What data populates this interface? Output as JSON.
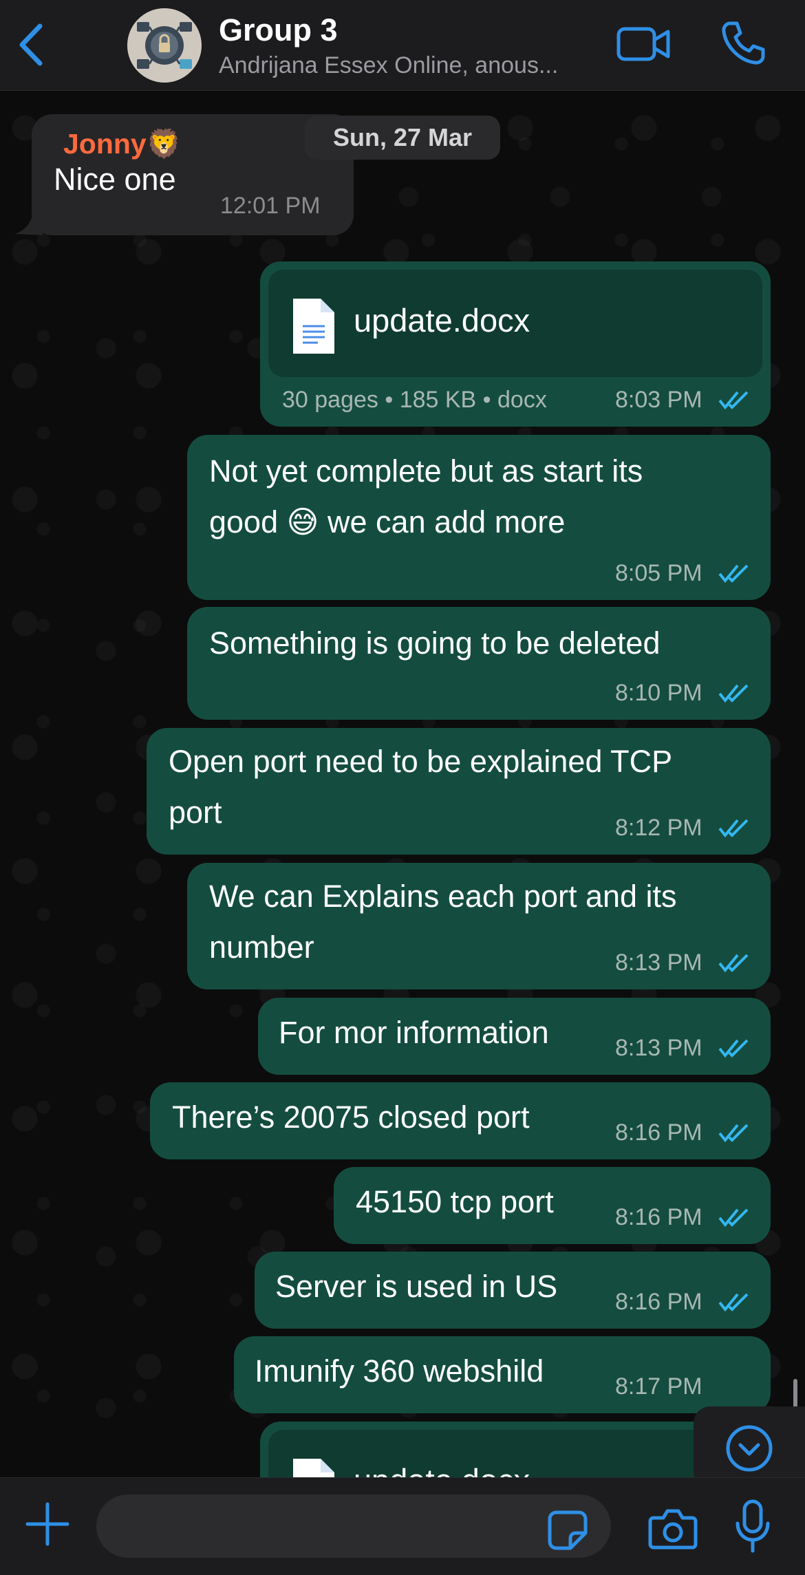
{
  "header": {
    "title": "Group 3",
    "subtitle": "Andrijana Essex Online, anous..."
  },
  "date_separator": "Sun, 27 Mar",
  "messages": [
    {
      "direction": "in",
      "sender": "Jonny",
      "sender_emoji": "🦁",
      "lines": [
        "Nice one"
      ],
      "time": "12:01 PM"
    },
    {
      "direction": "out",
      "type": "document",
      "file_name": "update.docx",
      "meta": "30 pages • 185 KB • docx",
      "time": "8:03 PM",
      "status": "read"
    },
    {
      "direction": "out",
      "lines": [
        "Not yet complete but as start its",
        "good 😅 we can add more"
      ],
      "time": "8:05 PM",
      "status": "read"
    },
    {
      "direction": "out",
      "lines": [
        "Something is going to be deleted"
      ],
      "time": "8:10 PM",
      "status": "read"
    },
    {
      "direction": "out",
      "lines": [
        "Open port need to be explained  TCP",
        "port"
      ],
      "time": "8:12 PM",
      "status": "read"
    },
    {
      "direction": "out",
      "lines": [
        "We can Explains each port and its",
        "number"
      ],
      "time": "8:13 PM",
      "status": "read"
    },
    {
      "direction": "out",
      "lines": [
        "For mor information"
      ],
      "time": "8:13 PM",
      "status": "read"
    },
    {
      "direction": "out",
      "lines": [
        "There’s 20075 closed port"
      ],
      "time": "8:16 PM",
      "status": "read"
    },
    {
      "direction": "out",
      "lines": [
        "45150 tcp port"
      ],
      "time": "8:16 PM",
      "status": "read"
    },
    {
      "direction": "out",
      "lines": [
        "Server is used in US"
      ],
      "time": "8:16 PM",
      "status": "read"
    },
    {
      "direction": "out",
      "lines": [
        "Imunify 360 webshild"
      ],
      "time": "8:17 PM",
      "status": "read"
    },
    {
      "direction": "out",
      "type": "document",
      "file_name": "update.docx",
      "partial": true
    }
  ],
  "composer": {
    "placeholder": ""
  },
  "colors": {
    "accent": "#2f8fe6",
    "outgoing_bubble": "#144d3f",
    "incoming_bubble": "#262628",
    "sender_name": "#ff6a3d",
    "read_ticks": "#34b7f1"
  },
  "icons": [
    "back-icon",
    "video-call-icon",
    "phone-icon",
    "document-icon",
    "read-ticks-icon",
    "scroll-down-icon",
    "plus-icon",
    "sticker-icon",
    "camera-icon",
    "microphone-icon"
  ]
}
